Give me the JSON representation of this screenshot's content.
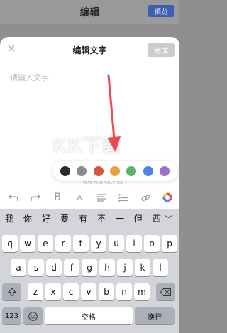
{
  "topbar": {
    "title": "编辑",
    "preview_label": "预览"
  },
  "sheet": {
    "title": "编辑文字",
    "done_label": "完成",
    "placeholder": "请输入文字"
  },
  "watermark": {
    "text": "KK下载",
    "url": "www.kkx.net"
  },
  "palette": {
    "colors": [
      "#2b2b2b",
      "#8a8a8a",
      "#d9533f",
      "#e7a13d",
      "#5ab56a",
      "#4a84e8",
      "#a070c9"
    ]
  },
  "toolbar": {
    "icons": [
      "undo-icon",
      "redo-icon",
      "bold-icon",
      "font-size-icon",
      "align-icon",
      "list-icon",
      "link-icon",
      "color-wheel-icon"
    ],
    "bold_label": "B",
    "font_label": "A"
  },
  "keyboard": {
    "candidates": [
      "我",
      "你",
      "好",
      "要",
      "有",
      "不",
      "一",
      "但",
      "西"
    ],
    "row1": [
      "q",
      "w",
      "e",
      "r",
      "t",
      "y",
      "u",
      "i",
      "o",
      "p"
    ],
    "row2": [
      "a",
      "s",
      "d",
      "f",
      "g",
      "h",
      "j",
      "k",
      "l"
    ],
    "row3": [
      "z",
      "x",
      "c",
      "v",
      "b",
      "n",
      "m"
    ],
    "num_label": "123",
    "space_label": "空格",
    "enter_label": "换行"
  }
}
